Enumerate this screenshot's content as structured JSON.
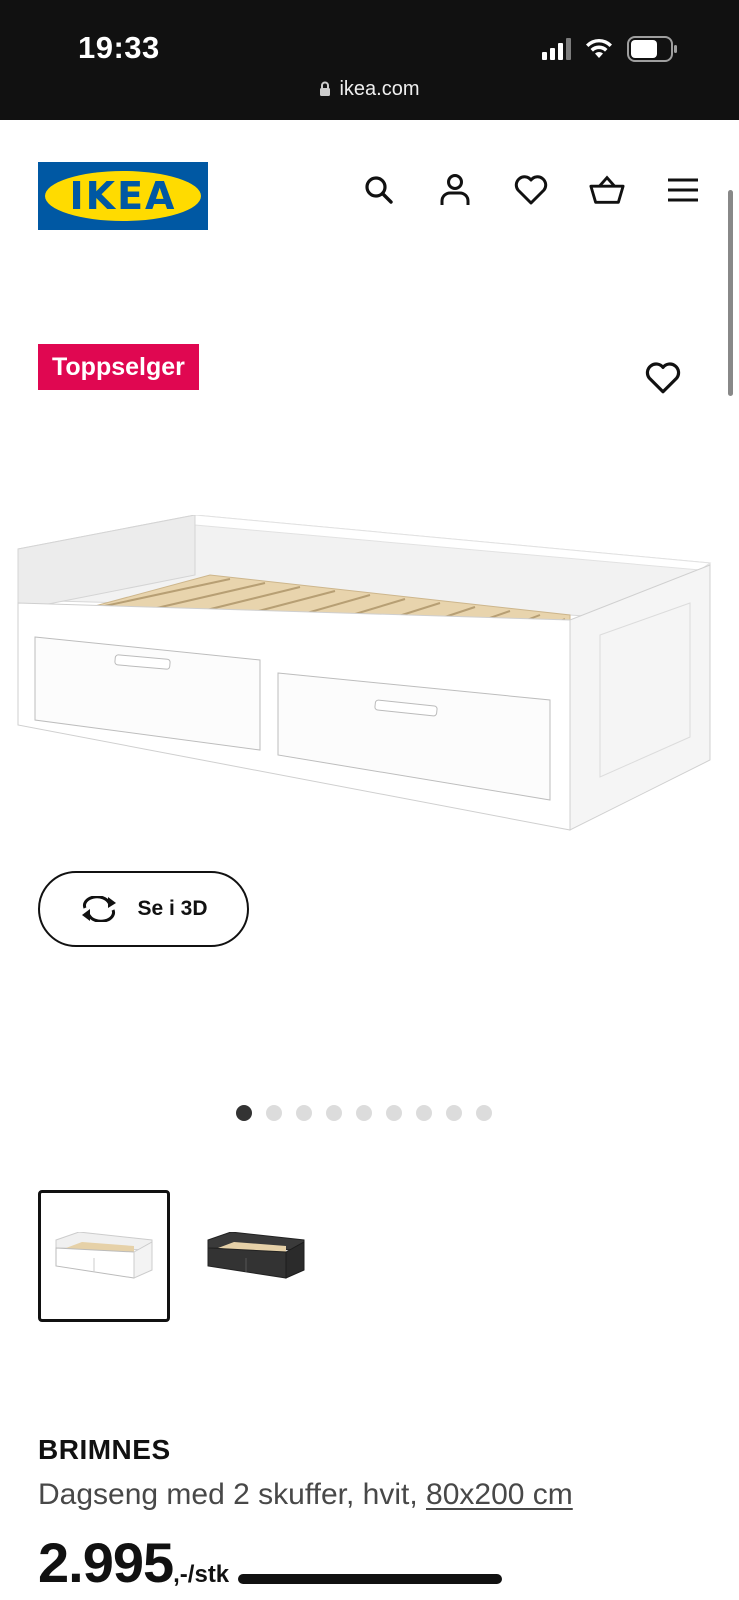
{
  "status_bar": {
    "time": "19:33",
    "url": "ikea.com"
  },
  "brand": {
    "logo_text": "IKEA",
    "logo_bg": "#0058a3",
    "logo_yellow": "#ffdb00"
  },
  "nav": {
    "icons": [
      "search-icon",
      "account-icon",
      "favourites-icon",
      "cart-icon",
      "menu-icon"
    ]
  },
  "product": {
    "badge": "Toppselger",
    "badge_color": "#e00751",
    "view_3d_label": "Se i 3D",
    "image_count": 9,
    "active_image": 1,
    "variants": [
      "white",
      "black-brown"
    ],
    "selected_variant": 0,
    "name": "BRIMNES",
    "description": "Dagseng med 2 skuffer, hvit,",
    "size_link": "80x200 cm",
    "price": "2.995",
    "price_suffix": ",-/stk"
  }
}
